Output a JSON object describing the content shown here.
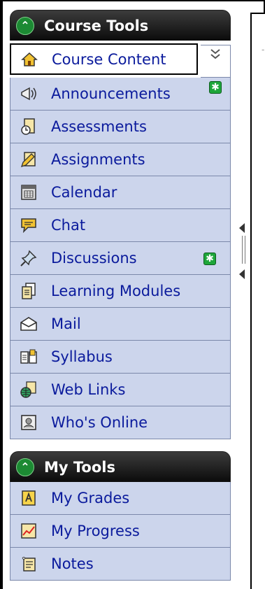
{
  "course_tools": {
    "title": "Course Tools",
    "collapse_icon": "double-chevron-up-icon",
    "expand_icon": "double-chevron-down-icon",
    "items": [
      {
        "label": "Course Content",
        "icon": "home-icon",
        "active": true
      },
      {
        "label": "Announcements",
        "icon": "megaphone-icon",
        "badge": "new-icon"
      },
      {
        "label": "Assessments",
        "icon": "clipboard-clock-icon"
      },
      {
        "label": "Assignments",
        "icon": "pencil-paper-icon"
      },
      {
        "label": "Calendar",
        "icon": "calendar-icon"
      },
      {
        "label": "Chat",
        "icon": "speech-bubble-icon"
      },
      {
        "label": "Discussions",
        "icon": "pushpin-icon",
        "badge": "new-icon"
      },
      {
        "label": "Learning Modules",
        "icon": "document-stack-icon"
      },
      {
        "label": "Mail",
        "icon": "envelope-icon"
      },
      {
        "label": "Syllabus",
        "icon": "open-book-icon"
      },
      {
        "label": "Web Links",
        "icon": "globe-icon"
      },
      {
        "label": "Who's Online",
        "icon": "person-portrait-icon"
      }
    ]
  },
  "my_tools": {
    "title": "My Tools",
    "collapse_icon": "double-chevron-up-icon",
    "items": [
      {
        "label": "My Grades",
        "icon": "grade-letter-icon"
      },
      {
        "label": "My Progress",
        "icon": "line-chart-icon"
      },
      {
        "label": "Notes",
        "icon": "note-icon"
      }
    ]
  },
  "colors": {
    "header_bg": "#0b0b0b",
    "item_bg": "#ccd5ec",
    "link_text": "#0a1a9c",
    "badge_green": "#1ea63a"
  }
}
